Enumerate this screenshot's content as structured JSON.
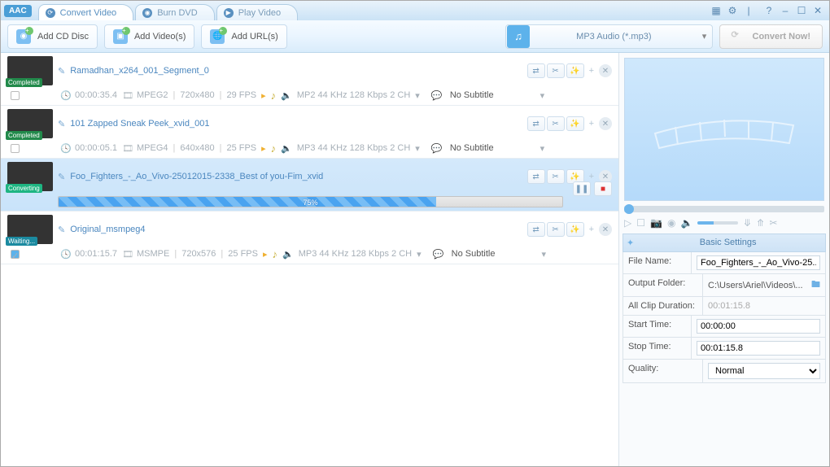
{
  "logo": "AAC",
  "tabs": [
    {
      "label": "Convert Video",
      "glyph": "⟳"
    },
    {
      "label": "Burn DVD",
      "glyph": "◉"
    },
    {
      "label": "Play Video",
      "glyph": "▶"
    }
  ],
  "win": {
    "grid": "▦",
    "gear": "⚙",
    "help": "?",
    "min": "–",
    "max": "☐",
    "close": "✕"
  },
  "toolbar": {
    "cd": "Add CD Disc",
    "vid": "Add Video(s)",
    "url": "Add URL(s)"
  },
  "format": {
    "label": "MP3 Audio (*.mp3)",
    "note": "♫"
  },
  "convert": "Convert Now!",
  "rows": [
    {
      "name": "Ramadhan_x264_001_Segment_0",
      "status": "Completed",
      "sc": "st-C",
      "dur": "00:00:35.4",
      "codec": "MPEG2",
      "res": "720x480",
      "fps": "29 FPS",
      "audio": "MP2 44 KHz 128 Kbps 2 CH",
      "sub": "No Subtitle",
      "ck": false
    },
    {
      "name": "101 Zapped Sneak Peek_xvid_001",
      "status": "Completed",
      "sc": "st-C",
      "dur": "00:00:05.1",
      "codec": "MPEG4",
      "res": "640x480",
      "fps": "25 FPS",
      "audio": "MP3 44 KHz 128 Kbps 2 CH",
      "sub": "No Subtitle",
      "ck": false
    },
    {
      "name": "Foo_Fighters_-_Ao_Vivo-25012015-2338_Best of you-Fim_xvid",
      "status": "Converting",
      "sc": "st-V",
      "progress": "75%"
    },
    {
      "name": "Original_msmpeg4",
      "status": "Waiting...",
      "sc": "st-W",
      "dur": "00:01:15.7",
      "codec": "MSMPE",
      "res": "720x576",
      "fps": "25 FPS",
      "audio": "MP3 44 KHz 128 Kbps 2 CH",
      "sub": "No Subtitle",
      "ck": true
    }
  ],
  "settings": {
    "title": "Basic Settings",
    "fileName": {
      "k": "File Name:",
      "v": "Foo_Fighters_-_Ao_Vivo-25..."
    },
    "folder": {
      "k": "Output Folder:",
      "v": "C:\\Users\\Ariel\\Videos\\..."
    },
    "clipDur": {
      "k": "All Clip Duration:",
      "v": "00:01:15.8"
    },
    "start": {
      "k": "Start Time:",
      "v": "00:00:00"
    },
    "stop": {
      "k": "Stop Time:",
      "v": "00:01:15.8"
    },
    "quality": {
      "k": "Quality:",
      "v": "Normal"
    }
  }
}
